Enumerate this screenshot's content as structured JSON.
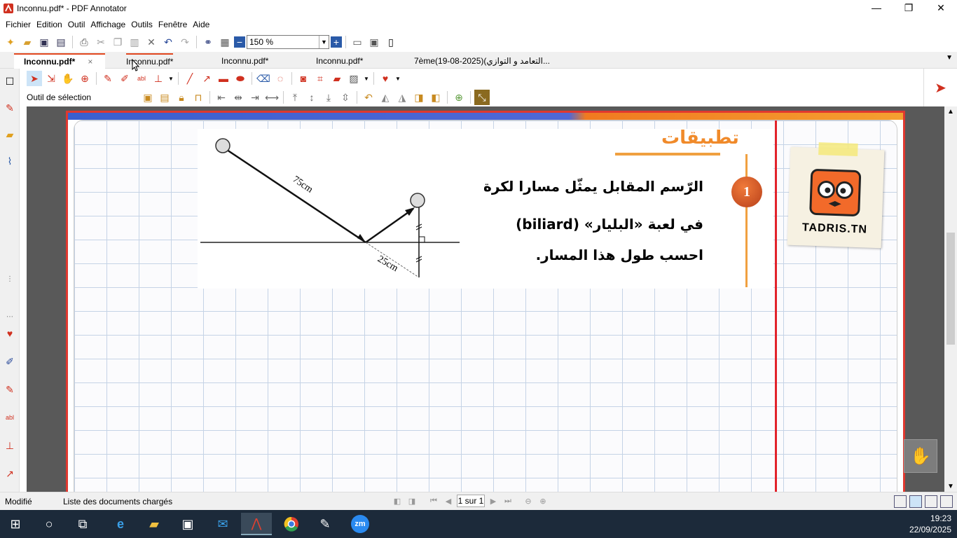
{
  "window": {
    "title": "Inconnu.pdf* - PDF Annotator",
    "minimize": "—",
    "maximize": "❐",
    "close": "✕"
  },
  "menu": [
    "Fichier",
    "Edition",
    "Outil",
    "Affichage",
    "Outils",
    "Fenêtre",
    "Aide"
  ],
  "toolbar": {
    "zoom": "150 %"
  },
  "tabs": [
    {
      "label": "Inconnu.pdf*",
      "close": "×"
    },
    {
      "label": "Inconnu.pdf*"
    },
    {
      "label": "Inconnu.pdf*"
    },
    {
      "label": "Inconnu.pdf*"
    },
    {
      "label": "7ème(19-08-2025)(التعامد و التوازي..."
    }
  ],
  "tool_label": "Outil de sélection",
  "page": {
    "exercise_title": "تطبيقات",
    "exercise_number": "1",
    "line1": "الرّسم المقابل يمثّل مسارا لكرة",
    "line2": "في لعبة «البليار» (biliard)",
    "line3": "احسب طول هذا المسار.",
    "label_75": "75cm",
    "label_25": "25cm",
    "logo_text": "TADRIS.TN"
  },
  "status": {
    "left": "Modifié",
    "mid": "Liste des documents chargés",
    "page_input": "1 sur 1"
  },
  "taskbar": {
    "time": "19:23",
    "date": "22/09/2025",
    "zm": "zm"
  },
  "colors": {
    "accent": "#e0461e",
    "page_border": "#e0382f",
    "orange": "#f08a2a",
    "grid": "#c5d3e6"
  }
}
